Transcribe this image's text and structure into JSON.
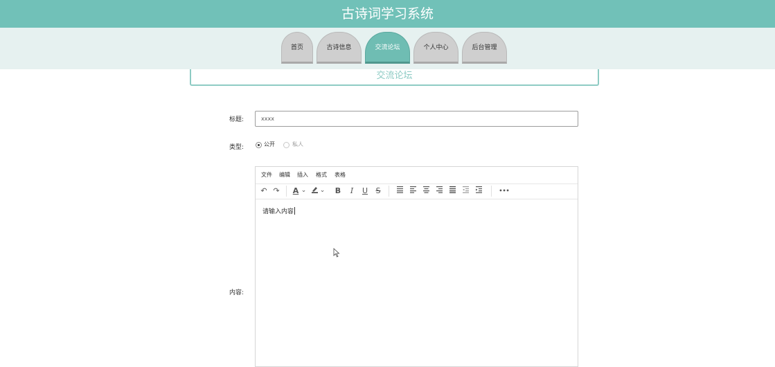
{
  "header": {
    "title": "古诗词学习系统"
  },
  "nav": {
    "tabs": [
      {
        "label": "首页"
      },
      {
        "label": "古诗信息"
      },
      {
        "label": "交流论坛"
      },
      {
        "label": "个人中心"
      },
      {
        "label": "后台管理"
      }
    ],
    "active_tab": "交流论坛"
  },
  "panel": {
    "title": "交流论坛"
  },
  "form": {
    "title_label": "标题:",
    "title_value": "xxxx",
    "type_label": "类型:",
    "type_options": [
      {
        "label": "公开",
        "checked": true
      },
      {
        "label": "私人",
        "checked": false
      }
    ],
    "content_label": "内容:"
  },
  "editor": {
    "menus": [
      "文件",
      "编辑",
      "插入",
      "格式",
      "表格"
    ],
    "toolbar": {
      "undo": "↶",
      "redo": "↷",
      "font_color": "A",
      "dropdown": "⌄",
      "highlight": "🖌",
      "bold": "B",
      "italic": "I",
      "underline": "U",
      "strikethrough": "S",
      "more": "•••"
    },
    "placeholder": "请输入内容"
  },
  "colors": {
    "header": "#71c1b8",
    "nav_bg": "#e6f1f0",
    "active_tab": "#6fbdb3",
    "tab": "#cfcfcf",
    "panel_border": "#8ecbc4"
  }
}
